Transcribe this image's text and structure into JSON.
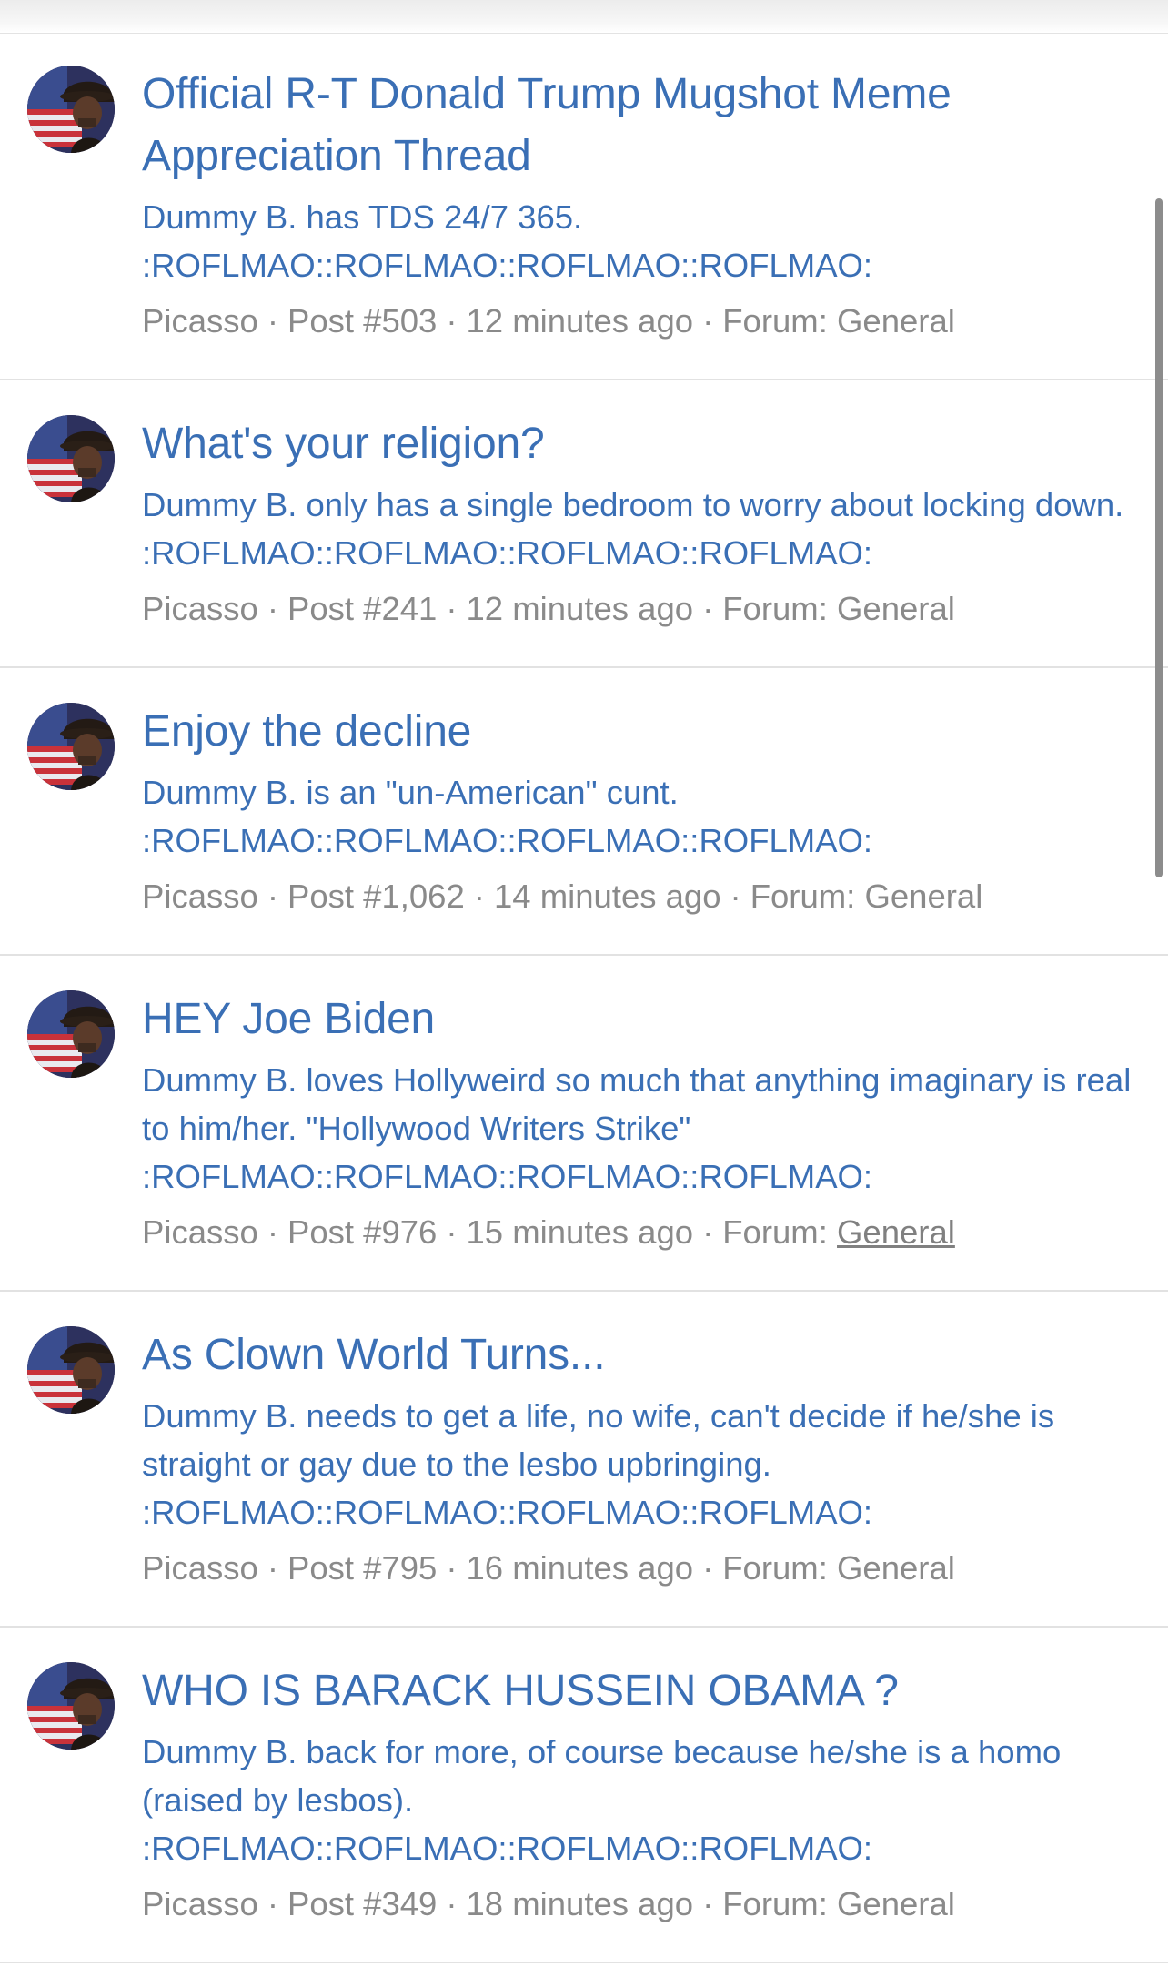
{
  "results": [
    {
      "title": "Official R-T Donald Trump Mugshot Meme Appreciation Thread",
      "snippet": "Dummy B. has TDS 24/7 365.\n:ROFLMAO::ROFLMAO::ROFLMAO::ROFLMAO:",
      "author": "Picasso",
      "post": "Post #503",
      "time": "12 minutes ago",
      "forum_label": "Forum:",
      "forum": "General"
    },
    {
      "title": "What's your religion?",
      "snippet": "Dummy B. only has a single bedroom to worry about locking down. :ROFLMAO::ROFLMAO::ROFLMAO::ROFLMAO:",
      "author": "Picasso",
      "post": "Post #241",
      "time": "12 minutes ago",
      "forum_label": "Forum:",
      "forum": "General"
    },
    {
      "title": "Enjoy the decline",
      "snippet": "Dummy B. is an \"un-American\" cunt.\n:ROFLMAO::ROFLMAO::ROFLMAO::ROFLMAO:",
      "author": "Picasso",
      "post": "Post #1,062",
      "time": "14 minutes ago",
      "forum_label": "Forum:",
      "forum": "General"
    },
    {
      "title": "HEY Joe Biden",
      "snippet": "Dummy B. loves Hollyweird so much that anything imaginary is real to him/her. \"Hollywood Writers Strike\"\n:ROFLMAO::ROFLMAO::ROFLMAO::ROFLMAO:",
      "author": "Picasso",
      "post": "Post #976",
      "time": "15 minutes ago",
      "forum_label": "Forum:",
      "forum": "General"
    },
    {
      "title": "As Clown World Turns...",
      "snippet": "Dummy B. needs to get a life, no wife, can't decide if he/she is straight or gay due to the lesbo upbringing.\n:ROFLMAO::ROFLMAO::ROFLMAO::ROFLMAO:",
      "author": "Picasso",
      "post": "Post #795",
      "time": "16 minutes ago",
      "forum_label": "Forum:",
      "forum": "General"
    },
    {
      "title": "WHO IS BARACK HUSSEIN OBAMA ?",
      "snippet": "Dummy B. back for more, of course because he/she is a homo (raised by lesbos).\n:ROFLMAO::ROFLMAO::ROFLMAO::ROFLMAO:",
      "author": "Picasso",
      "post": "Post #349",
      "time": "18 minutes ago",
      "forum_label": "Forum:",
      "forum": "General"
    }
  ],
  "colors": {
    "link": "#3a6fb5",
    "meta": "#8a8a8a",
    "divider": "#e2e2e2"
  },
  "icons": {
    "avatar": "user-avatar-cowboy-flag"
  }
}
